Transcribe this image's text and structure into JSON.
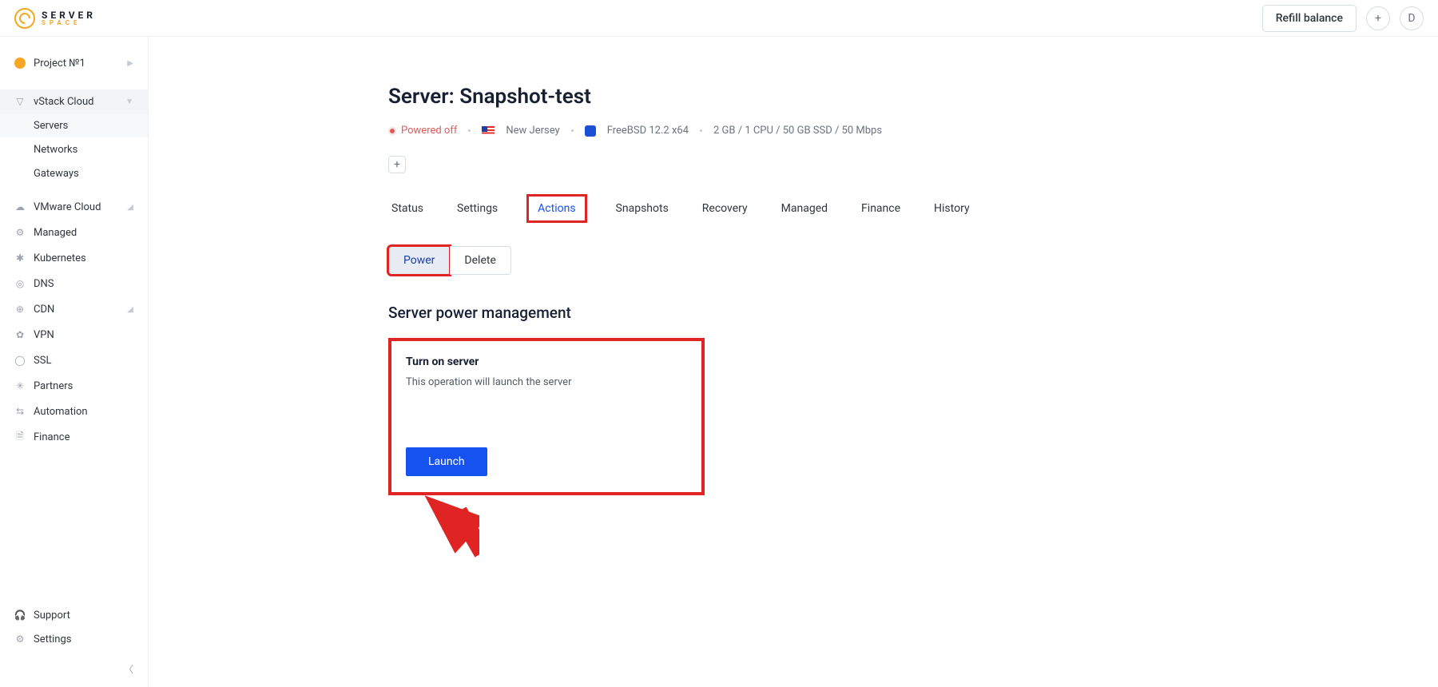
{
  "brand": {
    "name": "SERVER",
    "sub": "SPACE"
  },
  "header": {
    "refill_label": "Refill balance",
    "avatar_initial": "D"
  },
  "sidebar": {
    "project_label": "Project №1",
    "sections": {
      "vstack": {
        "label": "vStack Cloud",
        "items": [
          "Servers",
          "Networks",
          "Gateways"
        ]
      },
      "vmware": {
        "label": "VMware Cloud"
      },
      "managed": {
        "label": "Managed"
      },
      "kubernetes": {
        "label": "Kubernetes"
      },
      "dns": {
        "label": "DNS"
      },
      "cdn": {
        "label": "CDN"
      },
      "vpn": {
        "label": "VPN"
      },
      "ssl": {
        "label": "SSL"
      },
      "partners": {
        "label": "Partners"
      },
      "automation": {
        "label": "Automation"
      },
      "finance": {
        "label": "Finance"
      }
    },
    "footer": {
      "support": "Support",
      "settings": "Settings"
    }
  },
  "page": {
    "title": "Server: Snapshot-test",
    "status": "Powered off",
    "location": "New Jersey",
    "os": "FreeBSD 12.2 x64",
    "specs": "2 GB / 1 CPU / 50 GB SSD / 50 Mbps",
    "tabs": [
      "Status",
      "Settings",
      "Actions",
      "Snapshots",
      "Recovery",
      "Managed",
      "Finance",
      "History"
    ],
    "subtabs": [
      "Power",
      "Delete"
    ],
    "section_heading": "Server power management",
    "card": {
      "title": "Turn on server",
      "desc": "This operation will launch the server",
      "button": "Launch"
    }
  }
}
